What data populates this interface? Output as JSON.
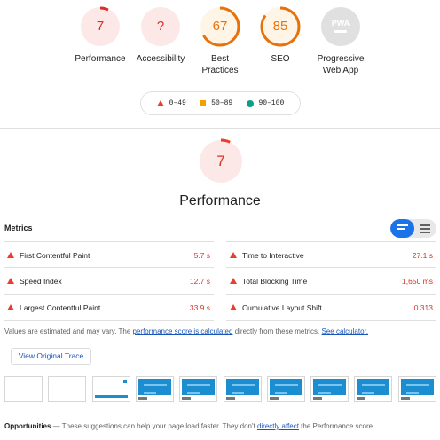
{
  "gauges": [
    {
      "label": "Performance",
      "score": "7",
      "color": "#d93025",
      "fill": "#fce8e6",
      "fraction": 0.07
    },
    {
      "label": "Accessibility",
      "score": "?",
      "color": "#d93025",
      "fill": "#fce8e6",
      "fraction": 0
    },
    {
      "label": "Best Practices",
      "score": "67",
      "color": "#e8710a",
      "fill": "#fef5e7",
      "fraction": 0.67
    },
    {
      "label": "SEO",
      "score": "85",
      "color": "#e8710a",
      "fill": "#fef5e7",
      "fraction": 0.85
    },
    {
      "label": "Progressive Web App",
      "score": "PWA",
      "color": "#9e9e9e",
      "fill": "#e0e0e0",
      "fraction": 0
    }
  ],
  "legend": {
    "fail": "0–49",
    "average": "50–89",
    "pass": "90–100"
  },
  "performance": {
    "score": "7",
    "fraction": 0.07,
    "title": "Performance"
  },
  "metrics": {
    "title": "Metrics",
    "left": [
      {
        "name": "First Contentful Paint",
        "value": "5.7 s"
      },
      {
        "name": "Speed Index",
        "value": "12.7 s"
      },
      {
        "name": "Largest Contentful Paint",
        "value": "33.9 s"
      }
    ],
    "right": [
      {
        "name": "Time to Interactive",
        "value": "27.1 s"
      },
      {
        "name": "Total Blocking Time",
        "value": "1,650 ms"
      },
      {
        "name": "Cumulative Layout Shift",
        "value": "0.313"
      }
    ]
  },
  "note": {
    "prefix": "Values are estimated and may vary. The ",
    "link1": "performance score is calculated",
    "middle": " directly from these metrics. ",
    "link2": "See calculator."
  },
  "trace_button": "View Original Trace",
  "filmstrip": [
    "blank",
    "blank",
    "partial",
    "full",
    "full",
    "full",
    "full",
    "full",
    "full",
    "full"
  ],
  "opportunities": {
    "title": "Opportunities",
    "prefix": " — These suggestions can help your page load faster. They don't ",
    "link": "directly affect",
    "suffix": " the Performance score."
  },
  "colors": {
    "fail": "#eb3c2f",
    "average": "#f4a000",
    "pass": "#0b9e8a",
    "link": "#1a56b9",
    "toggle": "#1a73e8"
  }
}
